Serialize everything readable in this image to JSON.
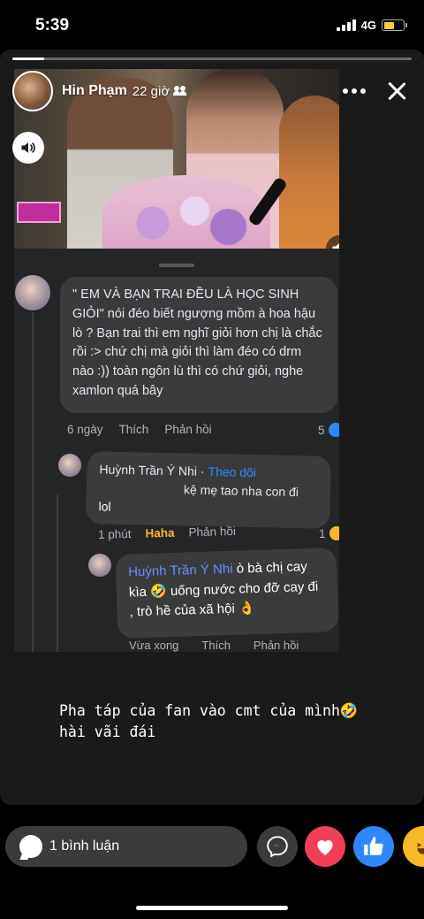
{
  "status_bar": {
    "time": "5:39",
    "network": "4G",
    "battery_level": 0.55
  },
  "story": {
    "progress": 0.08,
    "author": "Hin Phạm",
    "time_ago": "22 giờ",
    "audience_icon": "people-icon"
  },
  "comments": [
    {
      "text": "\" EM VÀ BẠN TRAI ĐỀU LÀ HỌC SINH GIỎI\" nói đéo biết ngượng mồm à hoa hậu lò ? Bạn trai thì em nghĩ giỏi hơn chị là chắc rồi :> chứ chị mà giỏi thì làm đéo có drm nào :)) toàn ngôn lù thì có chứ giỏi, nghe xamlon quá bây",
      "time": "6 ngày",
      "like_label": "Thích",
      "reply_label": "Phản hồi",
      "reactions": "5"
    },
    {
      "name": "Huỳnh Trần Ý Nhi ·",
      "follow": "Theo dõi",
      "line2": "kệ mẹ tao nha con đi",
      "line3": "lol",
      "time": "1 phút",
      "like_label": "Haha",
      "reply_label": "Phản hồi",
      "reactions": "1"
    },
    {
      "name": "Huỳnh Trần Ý Nhi",
      "text": " ò bà chị cay kìa 🤣 uống nước cho đỡ cay đi , trò hề của xã hội 👌",
      "time": "Vừa xong",
      "like_label": "Thích",
      "reply_label": "Phản hồi"
    }
  ],
  "caption": "Pha táp của fan vào cmt của mình🤣\nhài vãi đái",
  "bottom_bar": {
    "reply_label": "1 bình luận",
    "colors": {
      "love": "#f33e58",
      "like": "#2d88ff",
      "haha": "#f7b928"
    }
  }
}
